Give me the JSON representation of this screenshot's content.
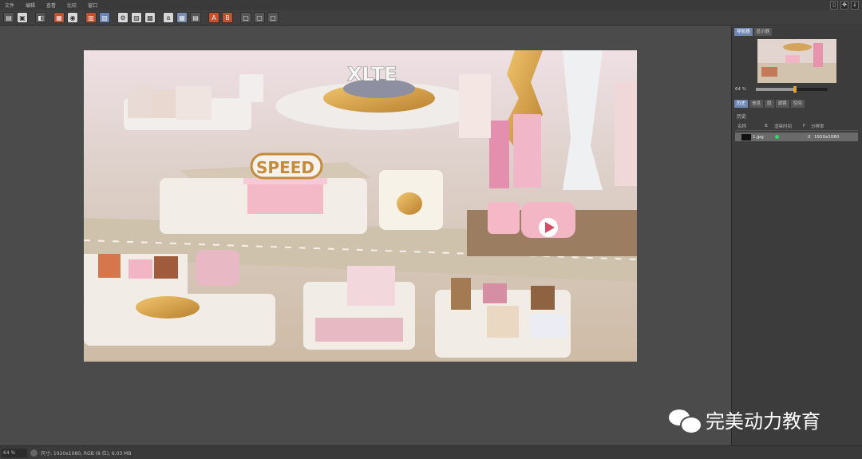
{
  "menu": [
    "文件",
    "编辑",
    "查看",
    "比较",
    "窗口"
  ],
  "window_controls": [
    "▯",
    "✥",
    "↓"
  ],
  "toolbar_icons": [
    "open-folder-icon",
    "save-icon",
    "compare-icon",
    "red-image-icon",
    "mask-icon",
    "layers-icon",
    "copy-icon",
    "settings-icon",
    "blue-image-icon",
    "grid-icon",
    "alpha-icon",
    "ab-icon",
    "ab-compare-icon",
    "split-icon",
    "channel-icon",
    "lock-icon"
  ],
  "panel": {
    "tabs": [
      "导航器",
      "显示器"
    ],
    "zoom": "64 %",
    "zoom_level": 0.55,
    "tabs2": [
      "历史",
      "信息",
      "层",
      "滤镜",
      "空间"
    ],
    "history_title": "历史",
    "columns": [
      "名称",
      "B",
      "渲染时间",
      "F",
      "分辨率"
    ],
    "row": {
      "name": "1.jpg",
      "frame": "0",
      "resolution": "1920x1080"
    }
  },
  "canvas_text": {
    "sign": "SPEED",
    "tower_logo": "XLTE"
  },
  "status": {
    "zoom": "64 %",
    "info": "尺寸: 1920x1080, RGB (8 位), 6.03 MB"
  },
  "watermark": "完美动力教育"
}
